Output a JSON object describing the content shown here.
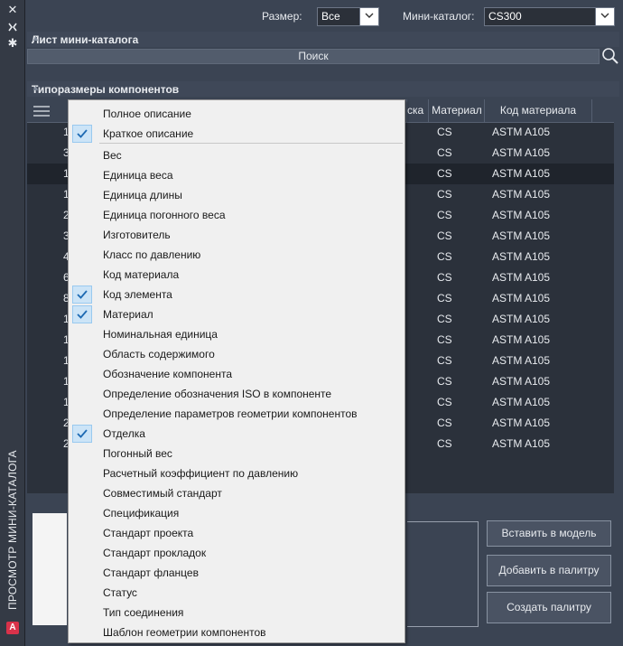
{
  "panel": {
    "vertical_title": "ПРОСМОТР МИНИ-КАТАЛОГА",
    "logo_letter": "A"
  },
  "filters": {
    "size_label": "Размер:",
    "size_value": "Все",
    "catalog_label": "Мини-каталог:",
    "catalog_value": "CS300"
  },
  "sheet": {
    "title": "Лист мини-каталога",
    "search_label": "Поиск"
  },
  "sizes": {
    "title": "Типоразмеры компонентов",
    "columns": [
      "ска",
      "Материал",
      "Код материала"
    ],
    "rows": [
      {
        "prefix": "1",
        "material": "CS",
        "code": "ASTM A105"
      },
      {
        "prefix": "3",
        "material": "CS",
        "code": "ASTM A105"
      },
      {
        "prefix": "1",
        "material": "CS",
        "code": "ASTM A105"
      },
      {
        "prefix": "1",
        "material": "CS",
        "code": "ASTM A105"
      },
      {
        "prefix": "2",
        "material": "CS",
        "code": "ASTM A105"
      },
      {
        "prefix": "3",
        "material": "CS",
        "code": "ASTM A105"
      },
      {
        "prefix": "4",
        "material": "CS",
        "code": "ASTM A105"
      },
      {
        "prefix": "6",
        "material": "CS",
        "code": "ASTM A105"
      },
      {
        "prefix": "8",
        "material": "CS",
        "code": "ASTM A105"
      },
      {
        "prefix": "1",
        "material": "CS",
        "code": "ASTM A105"
      },
      {
        "prefix": "1",
        "material": "CS",
        "code": "ASTM A105"
      },
      {
        "prefix": "1",
        "material": "CS",
        "code": "ASTM A105"
      },
      {
        "prefix": "1",
        "material": "CS",
        "code": "ASTM A105"
      },
      {
        "prefix": "1",
        "material": "CS",
        "code": "ASTM A105"
      },
      {
        "prefix": "2",
        "material": "CS",
        "code": "ASTM A105"
      },
      {
        "prefix": "2",
        "material": "CS",
        "code": "ASTM A105"
      }
    ]
  },
  "buttons": {
    "insert": "Вставить в модель",
    "add": "Добавить в палитру",
    "create": "Создать палитру"
  },
  "column_menu": {
    "items": [
      {
        "label": "Полное описание",
        "checked": false
      },
      {
        "label": "Краткое описание",
        "checked": true
      },
      {
        "label": "Вес",
        "checked": false
      },
      {
        "label": "Единица веса",
        "checked": false
      },
      {
        "label": "Единица длины",
        "checked": false
      },
      {
        "label": "Единица погонного веса",
        "checked": false
      },
      {
        "label": "Изготовитель",
        "checked": false
      },
      {
        "label": "Класс по давлению",
        "checked": false
      },
      {
        "label": "Код материала",
        "checked": false
      },
      {
        "label": "Код элемента",
        "checked": true
      },
      {
        "label": "Материал",
        "checked": true
      },
      {
        "label": "Номинальная единица",
        "checked": false
      },
      {
        "label": "Область содержимого",
        "checked": false
      },
      {
        "label": "Обозначение компонента",
        "checked": false
      },
      {
        "label": "Определение обозначения ISO в компоненте",
        "checked": false
      },
      {
        "label": "Определение параметров геометрии компонентов",
        "checked": false
      },
      {
        "label": "Отделка",
        "checked": true
      },
      {
        "label": "Погонный вес",
        "checked": false
      },
      {
        "label": "Расчетный коэффициент по давлению",
        "checked": false
      },
      {
        "label": "Совместимый стандарт",
        "checked": false
      },
      {
        "label": "Спецификация",
        "checked": false
      },
      {
        "label": "Стандарт проекта",
        "checked": false
      },
      {
        "label": "Стандарт прокладок",
        "checked": false
      },
      {
        "label": "Стандарт фланцев",
        "checked": false
      },
      {
        "label": "Статус",
        "checked": false
      },
      {
        "label": "Тип соединения",
        "checked": false
      },
      {
        "label": "Шаблон геометрии компонентов",
        "checked": false
      }
    ]
  },
  "colors": {
    "panel_bg": "#3b4453",
    "grid_bg": "#2b313b",
    "selected_row": "#1f242c",
    "menu_bg": "#f0f0f0",
    "check_bg": "#cce4f7",
    "check_mark": "#1e6ab3"
  }
}
